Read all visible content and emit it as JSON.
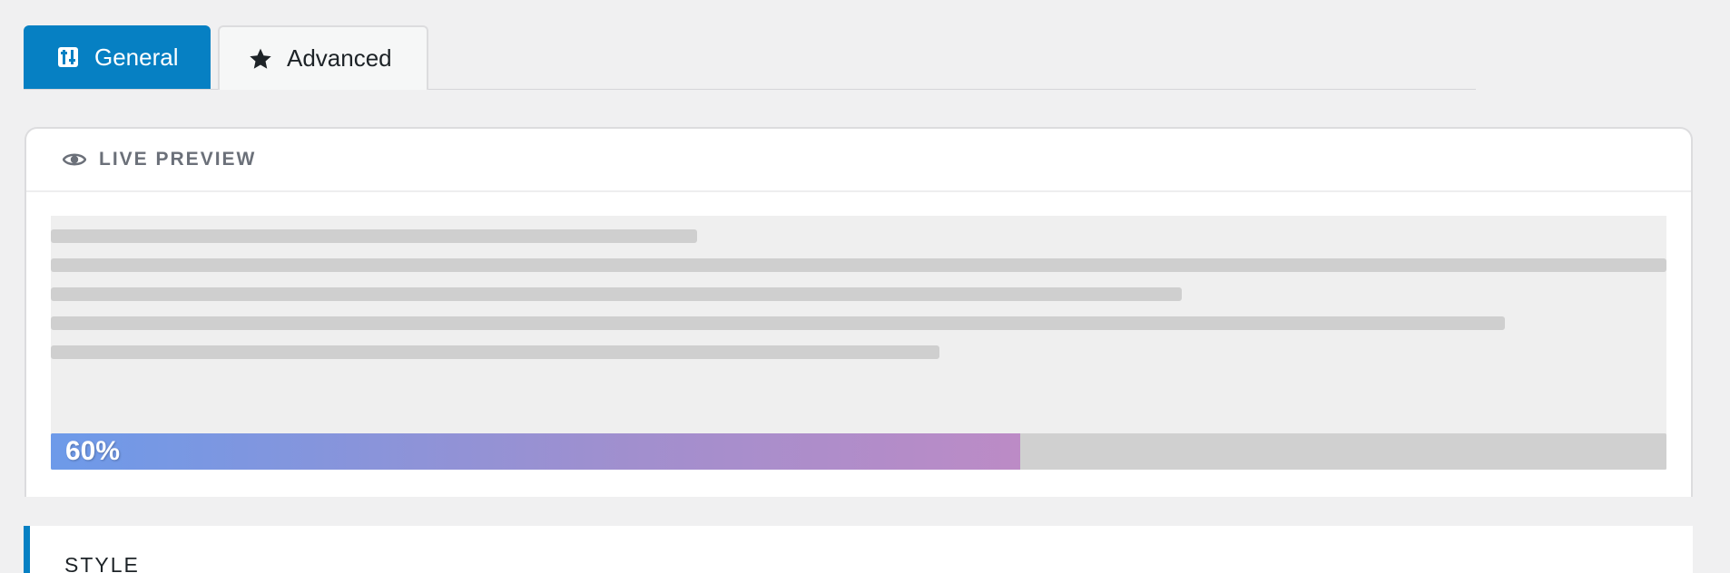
{
  "tabs": [
    {
      "label": "General",
      "icon": "sliders-icon",
      "active": true
    },
    {
      "label": "Advanced",
      "icon": "star-icon",
      "active": false
    }
  ],
  "preview": {
    "title": "LIVE PREVIEW",
    "icon": "eye-icon",
    "progress": {
      "value": 0.6,
      "label": "60%"
    }
  },
  "style_section": {
    "title": "STYLE"
  },
  "colors": {
    "accent": "#0680c3",
    "progress_start": "#6d9ae9",
    "progress_end": "#bc8bc6",
    "track": "#d0d0d0"
  }
}
